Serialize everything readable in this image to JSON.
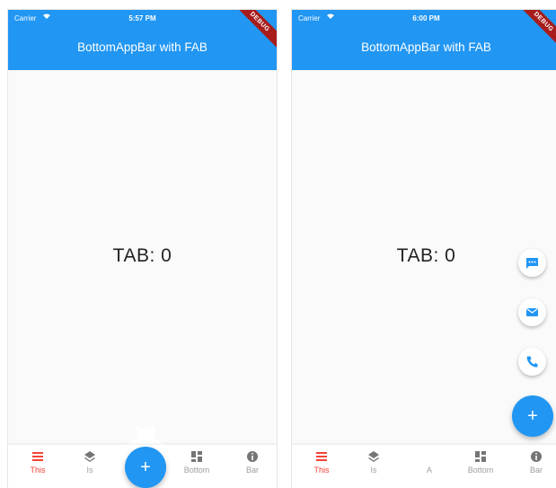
{
  "screens": [
    {
      "status": {
        "carrier": "Carrier",
        "time": "5:57 PM"
      },
      "appbar_title": "BottomAppBar with FAB",
      "debug_banner": "DEBUG",
      "content_text": "TAB: 0",
      "fab": {
        "icon": "add-icon",
        "label": "+"
      },
      "nav_items": [
        {
          "label": "This",
          "icon": "menu-icon",
          "active": true
        },
        {
          "label": "Is",
          "icon": "layers-icon",
          "active": false
        },
        {
          "label": "Bottom",
          "icon": "dashboard-icon",
          "active": false
        },
        {
          "label": "Bar",
          "icon": "info-icon",
          "active": false
        }
      ]
    },
    {
      "status": {
        "carrier": "Carrier",
        "time": "6:00 PM"
      },
      "appbar_title": "BottomAppBar with FAB",
      "debug_banner": "DEBUG",
      "content_text": "TAB: 0",
      "fab": {
        "icon": "add-icon",
        "label": "+"
      },
      "mini_fabs": [
        {
          "icon": "sms-icon"
        },
        {
          "icon": "mail-icon"
        },
        {
          "icon": "phone-icon"
        }
      ],
      "nav_items": [
        {
          "label": "This",
          "icon": "menu-icon",
          "active": true
        },
        {
          "label": "Is",
          "icon": "layers-icon",
          "active": false
        },
        {
          "label": "A",
          "icon": "",
          "active": false
        },
        {
          "label": "Bottom",
          "icon": "dashboard-icon",
          "active": false
        },
        {
          "label": "Bar",
          "icon": "info-icon",
          "active": false
        }
      ]
    }
  ],
  "colors": {
    "primary": "#2196f3",
    "active_nav": "#f44336",
    "inactive_nav": "#9e9e9e",
    "debug_banner": "#a81c1c",
    "background": "#fafafa"
  }
}
